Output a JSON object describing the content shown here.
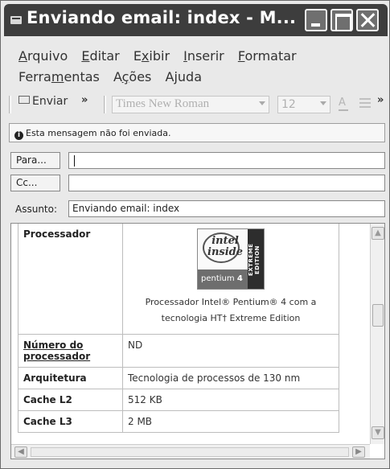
{
  "window": {
    "title": "Enviando email: index - M...",
    "controls": [
      "minimize-icon",
      "maximize-icon",
      "close-icon"
    ]
  },
  "menu": {
    "items": [
      {
        "pre": "",
        "key": "A",
        "post": "rquivo"
      },
      {
        "pre": "",
        "key": "E",
        "post": "ditar"
      },
      {
        "pre": "E",
        "key": "x",
        "post": "ibir"
      },
      {
        "pre": "",
        "key": "I",
        "post": "nserir"
      },
      {
        "pre": "",
        "key": "F",
        "post": "ormatar"
      },
      {
        "pre": "Ferra",
        "key": "m",
        "post": "entas"
      },
      {
        "pre": "A",
        "key": "ç",
        "post": "ões"
      },
      {
        "pre": "A",
        "key": "j",
        "post": "uda"
      }
    ]
  },
  "toolbar": {
    "send_label": "Enviar",
    "chevron": "»",
    "font_value": "Times New Roman",
    "size_value": "12",
    "color_glyph": "A"
  },
  "infobar": {
    "icon": "info-icon",
    "message": "Esta mensagem não foi enviada."
  },
  "fields": {
    "to_label": "Para...",
    "cc_label": "Cc...",
    "subject_label": "Assunto:",
    "subject_value": "Enviando email: index",
    "to_value": "",
    "cc_value": ""
  },
  "content": {
    "logo": {
      "brand_top": "intel",
      "brand_bottom": "inside",
      "product": "pentium",
      "model": "4",
      "edition": "EXTREME EDITION"
    },
    "rows": [
      {
        "label": "Processador",
        "value": "",
        "caption_line1": "Processador Intel® Pentium® 4 com a",
        "caption_line2": "tecnologia HT† Extreme Edition"
      },
      {
        "label": "Número do processador",
        "value": "ND"
      },
      {
        "label": "Arquitetura",
        "value": "Tecnologia de processos de 130 nm"
      },
      {
        "label": "Cache L2",
        "value": "512 KB"
      },
      {
        "label": "Cache L3",
        "value": "2 MB"
      }
    ]
  }
}
